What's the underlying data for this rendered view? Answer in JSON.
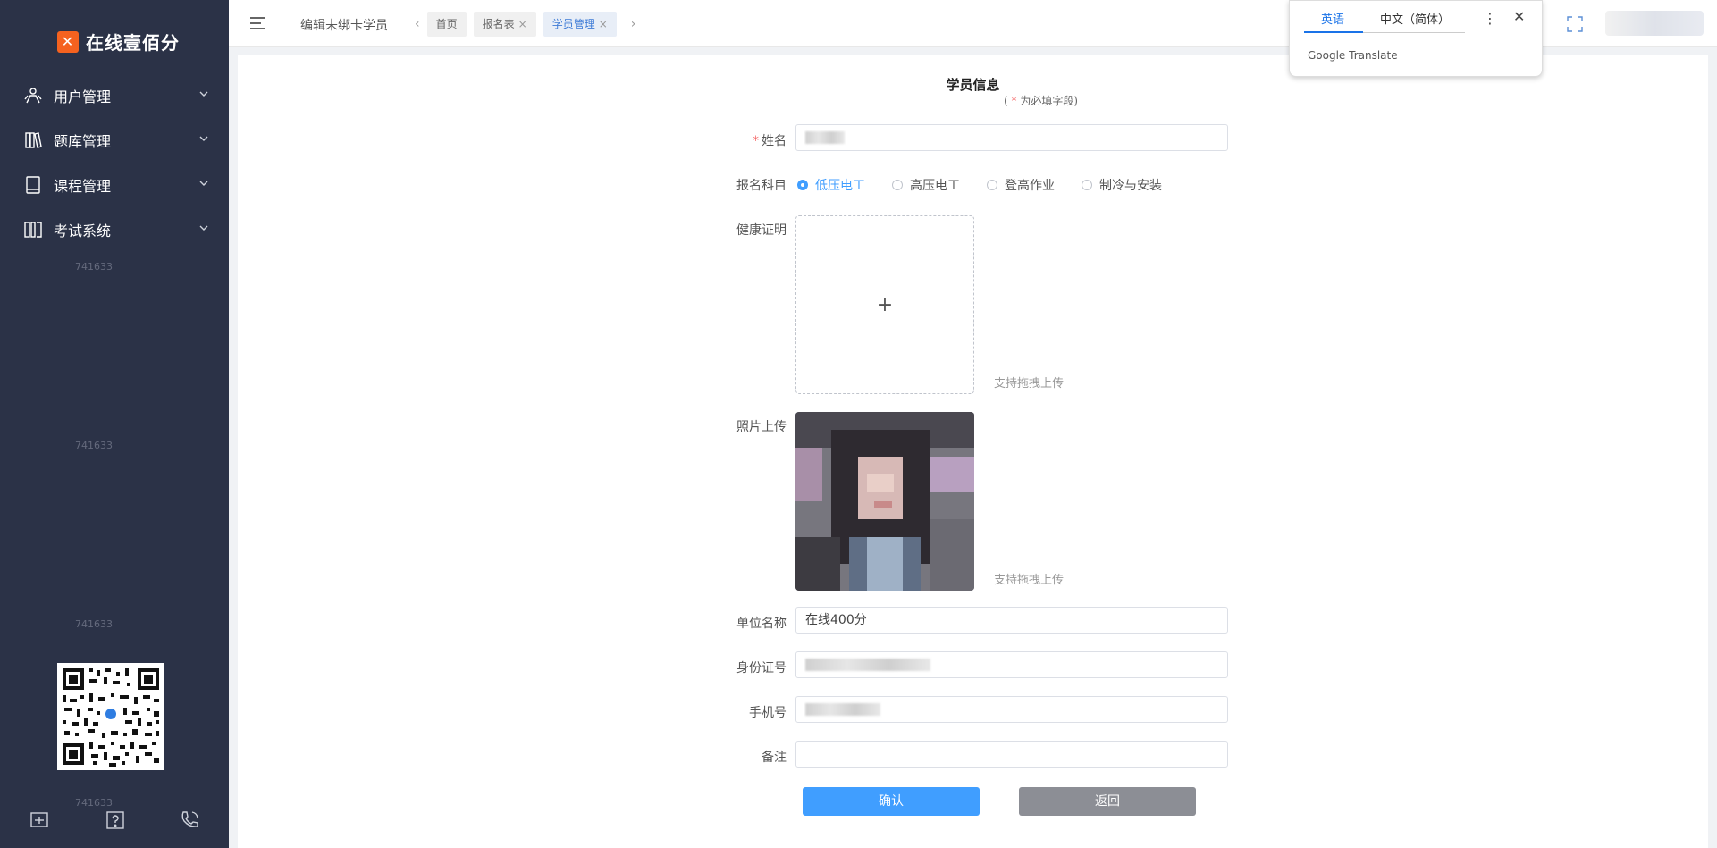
{
  "sidebar": {
    "brand": "在线壹佰分",
    "menu": [
      {
        "label": "用户管理",
        "icon": "users-icon"
      },
      {
        "label": "题库管理",
        "icon": "books-icon"
      },
      {
        "label": "课程管理",
        "icon": "book-icon"
      },
      {
        "label": "考试系统",
        "icon": "exam-icon"
      }
    ],
    "watermark": "741633"
  },
  "header": {
    "page_title": "编辑未绑卡学员",
    "tabs": [
      {
        "label": "首页",
        "closable": false,
        "active": false
      },
      {
        "label": "报名表",
        "closable": true,
        "active": false
      },
      {
        "label": "学员管理",
        "closable": true,
        "active": true
      }
    ]
  },
  "translate_popup": {
    "tab_english": "英语",
    "tab_chinese": "中文（简体）",
    "brand": "Google Translate"
  },
  "form": {
    "title": "学员信息",
    "subtitle_prefix": "(",
    "subtitle_star": "*",
    "subtitle_text": "为必填字段)",
    "name_label": "姓名",
    "subject_label": "报名科目",
    "subjects": [
      "低压电工",
      "高压电工",
      "登高作业",
      "制冷与安装"
    ],
    "selected_subject": "低压电工",
    "health_label": "健康证明",
    "upload_plus": "+",
    "drag_hint": "支持拖拽上传",
    "photo_label": "照片上传",
    "company_label": "单位名称",
    "company_value": "在线400分",
    "id_label": "身份证号",
    "phone_label": "手机号",
    "remark_label": "备注",
    "remark_value": "",
    "confirm_label": "确认",
    "back_label": "返回"
  },
  "colors": {
    "sidebar_bg": "#2b3247",
    "primary": "#409eff",
    "brand_orange": "#f5621f",
    "required": "#f56c6c"
  }
}
